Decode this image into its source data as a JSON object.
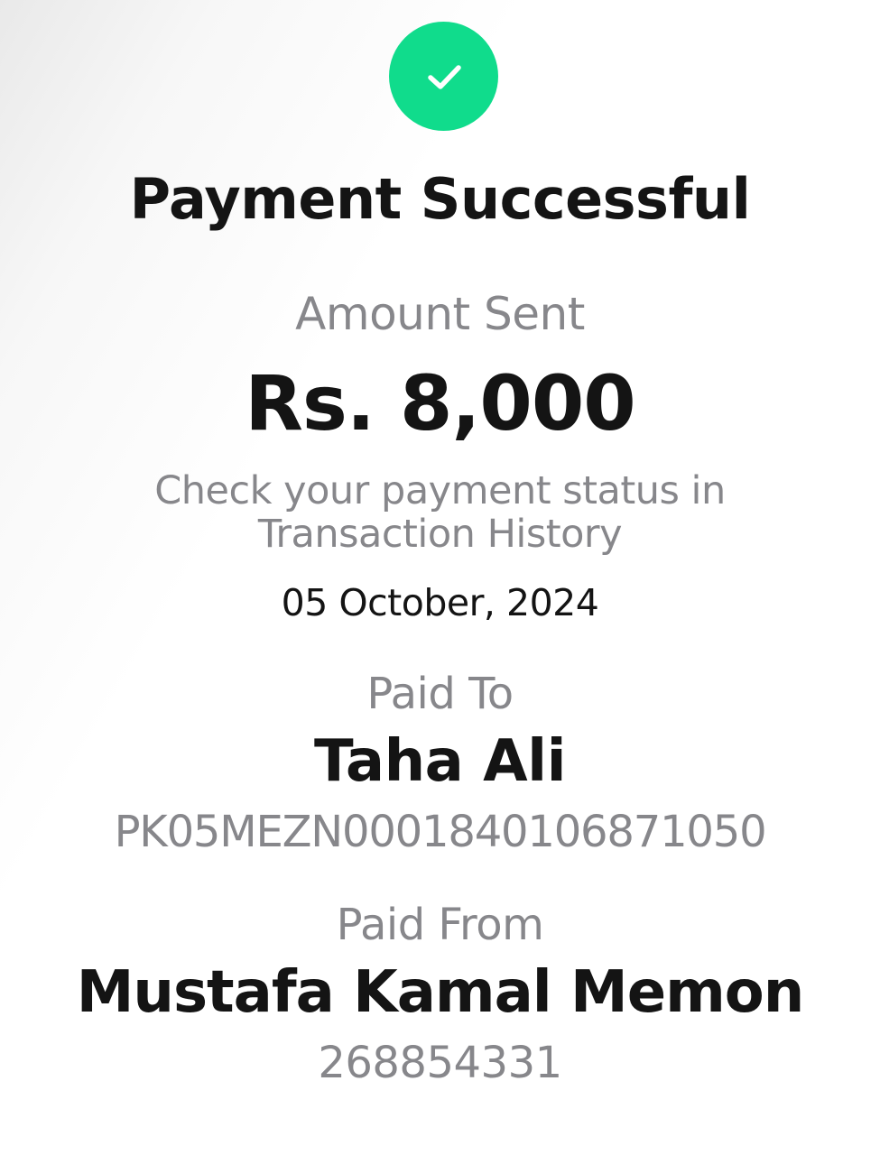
{
  "colors": {
    "success": "#10dc8c",
    "primary_text": "#141414",
    "muted_text": "#87878b"
  },
  "icons": {
    "status": "checkmark-icon"
  },
  "receipt": {
    "title": "Payment Successful",
    "amount_label": "Amount Sent",
    "amount": "Rs. 8,000",
    "status_hint_line1": "Check your payment status in",
    "status_hint_line2": "Transaction History",
    "date": "05 October, 2024",
    "paid_to": {
      "label": "Paid To",
      "name": "Taha Ali",
      "account": "PK05MEZN0001840106871050"
    },
    "paid_from": {
      "label": "Paid From",
      "name": "Mustafa Kamal Memon",
      "account": "268854331"
    }
  }
}
